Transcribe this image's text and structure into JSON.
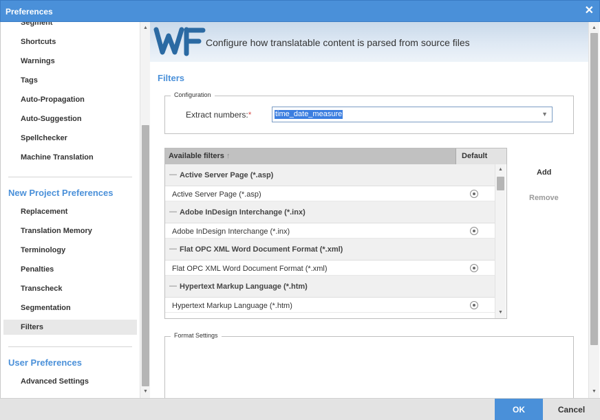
{
  "window": {
    "title": "Preferences",
    "close_glyph": "✕"
  },
  "sidebar": {
    "top_items": [
      {
        "label": "Segment"
      },
      {
        "label": "Shortcuts"
      },
      {
        "label": "Warnings"
      },
      {
        "label": "Tags"
      },
      {
        "label": "Auto-Propagation"
      },
      {
        "label": "Auto-Suggestion"
      },
      {
        "label": "Spellchecker"
      },
      {
        "label": "Machine Translation"
      }
    ],
    "new_project_heading": "New Project Preferences",
    "new_project_items": [
      {
        "label": "Replacement"
      },
      {
        "label": "Translation Memory"
      },
      {
        "label": "Terminology"
      },
      {
        "label": "Penalties"
      },
      {
        "label": "Transcheck"
      },
      {
        "label": "Segmentation"
      },
      {
        "label": "Filters",
        "selected": true
      }
    ],
    "user_heading": "User Preferences",
    "user_items": [
      {
        "label": "Advanced Settings"
      }
    ]
  },
  "banner": {
    "logo": "wf-logo",
    "text": "Configure how translatable content is parsed from source files",
    "colors": {
      "logo_blue": "#2b6aa3"
    }
  },
  "filters": {
    "title": "Filters",
    "configuration_legend": "Configuration",
    "extract_label": "Extract numbers:",
    "required_marker": "*",
    "extract_value": "time_date_measure",
    "table": {
      "col_name": "Available filters",
      "sort_glyph": "↑",
      "col_default": "Default",
      "groups": [
        {
          "group": "Active Server Page (*.asp)",
          "item": "Active Server Page (*.asp)"
        },
        {
          "group": "Adobe InDesign Interchange (*.inx)",
          "item": "Adobe InDesign Interchange (*.inx)"
        },
        {
          "group": "Flat OPC XML Word Document Format (*.xml)",
          "item": "Flat OPC XML Word Document Format (*.xml)"
        },
        {
          "group": "Hypertext Markup Language (*.htm)",
          "item": "Hypertext Markup Language (*.htm)"
        }
      ]
    },
    "add_label": "Add",
    "remove_label": "Remove",
    "format_settings_legend": "Format Settings"
  },
  "footer": {
    "ok_label": "OK",
    "cancel_label": "Cancel"
  },
  "colors": {
    "accent": "#4a90d9",
    "selection": "#3b7ee0",
    "required": "#d9534f"
  }
}
